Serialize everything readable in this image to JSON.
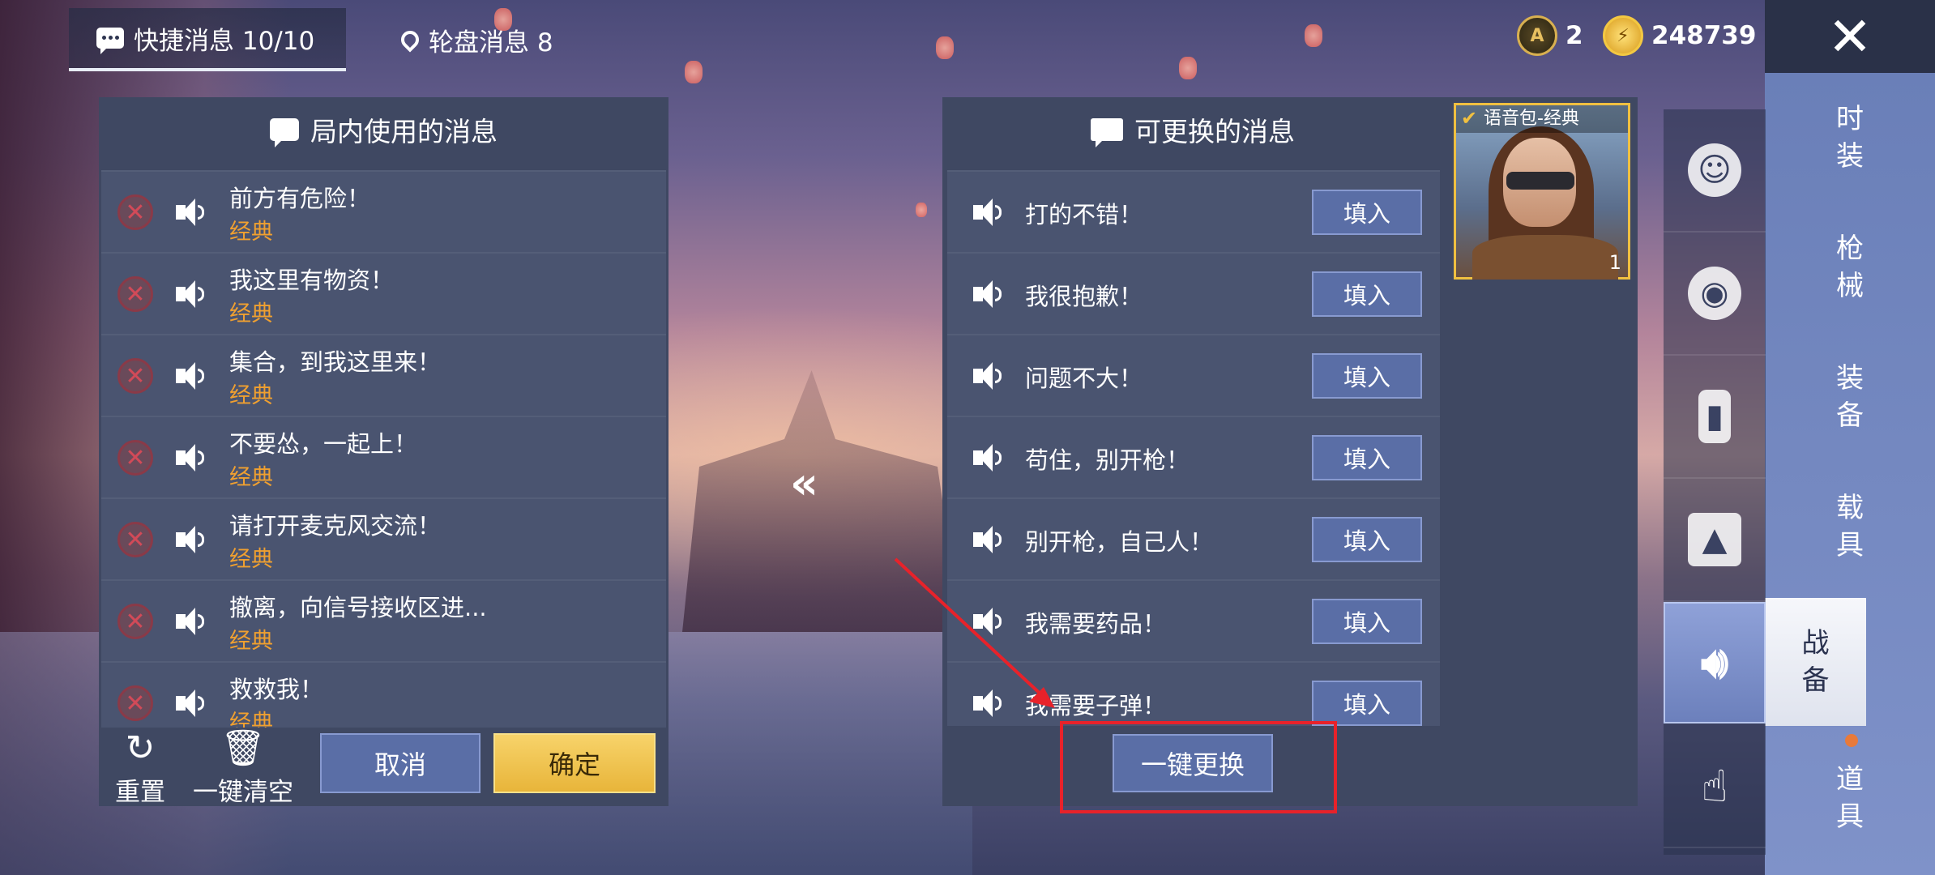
{
  "top_tabs": [
    {
      "label": "快捷消息 10/10"
    },
    {
      "label": "轮盘消息 8"
    }
  ],
  "currency": [
    {
      "icon": "gold-token-icon",
      "value": "2"
    },
    {
      "icon": "coin-icon",
      "value": "248739"
    }
  ],
  "close_icon": "close-icon",
  "categories": [
    {
      "label": "时装"
    },
    {
      "label": "枪械"
    },
    {
      "label": "装备"
    },
    {
      "label": "载具"
    },
    {
      "label": "战备"
    },
    {
      "label": "道具"
    }
  ],
  "side_icons": [
    "emote-icon",
    "robot-icon",
    "spray-icon",
    "gallery-icon",
    "speaker-icon",
    "tap-icon"
  ],
  "left_panel": {
    "title": "局内使用的消息",
    "items": [
      {
        "text": "前方有危险！",
        "tag": "经典"
      },
      {
        "text": "我这里有物资！",
        "tag": "经典"
      },
      {
        "text": "集合，到我这里来！",
        "tag": "经典"
      },
      {
        "text": "不要怂，一起上！",
        "tag": "经典"
      },
      {
        "text": "请打开麦克风交流！",
        "tag": "经典"
      },
      {
        "text": "撤离，向信号接收区进...",
        "tag": "经典"
      },
      {
        "text": "救救我！",
        "tag": "经典"
      }
    ],
    "reset_label": "重置",
    "clear_label": "一键清空",
    "cancel_label": "取消",
    "confirm_label": "确定"
  },
  "right_panel": {
    "title": "可更换的消息",
    "fill_label": "填入",
    "items": [
      {
        "text": "打的不错！"
      },
      {
        "text": "我很抱歉！"
      },
      {
        "text": "问题不大！"
      },
      {
        "text": "苟住，别开枪！"
      },
      {
        "text": "别开枪，自己人！"
      },
      {
        "text": "我需要药品！"
      },
      {
        "text": "我需要子弹！"
      }
    ],
    "replace_all_label": "一键更换"
  },
  "voice_pack": {
    "label": "语音包-经典",
    "count": "1"
  },
  "swap_symbol": "«"
}
